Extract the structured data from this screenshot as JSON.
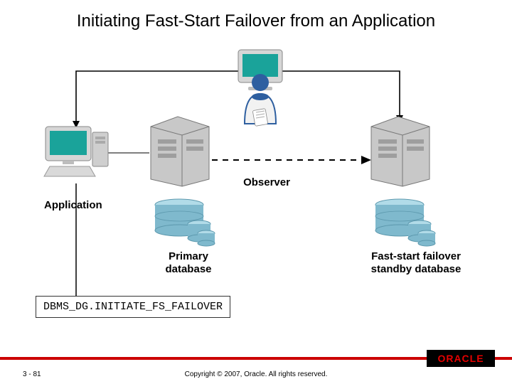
{
  "title": "Initiating Fast-Start Failover from an Application",
  "labels": {
    "observer": "Observer",
    "application": "Application",
    "primary": "Primary\ndatabase",
    "standby": "Fast-start failover\nstandby database"
  },
  "code": "DBMS_DG.INITIATE_FS_FAILOVER",
  "footer": {
    "page": "3 - 81",
    "copyright": "Copyright © 2007, Oracle. All rights reserved.",
    "logo": "ORACLE"
  },
  "diagram": {
    "nodes": [
      {
        "id": "application-pc",
        "type": "desktop-pc"
      },
      {
        "id": "observer-person",
        "type": "person-with-monitor"
      },
      {
        "id": "primary-server",
        "type": "server"
      },
      {
        "id": "standby-server",
        "type": "server"
      },
      {
        "id": "primary-db",
        "type": "database-stack"
      },
      {
        "id": "standby-db",
        "type": "database-stack"
      }
    ],
    "connections": [
      {
        "from": "observer-person",
        "to": "application-pc",
        "style": "solid-arrow"
      },
      {
        "from": "observer-person",
        "to": "standby-server",
        "style": "solid-arrow"
      },
      {
        "from": "application-pc",
        "to": "primary-server",
        "style": "solid"
      },
      {
        "from": "primary-server",
        "to": "standby-server",
        "style": "dashed-arrow"
      },
      {
        "from": "application-pc",
        "to": "code-box",
        "style": "solid"
      }
    ]
  },
  "colors": {
    "monitor_screen": "#1aa39a",
    "server_body": "#c8c8c8",
    "db_top": "#b1dbe8",
    "db_side": "#7fb9cd",
    "person_body": "#2e5fa0",
    "accent_red": "#cc0000"
  }
}
